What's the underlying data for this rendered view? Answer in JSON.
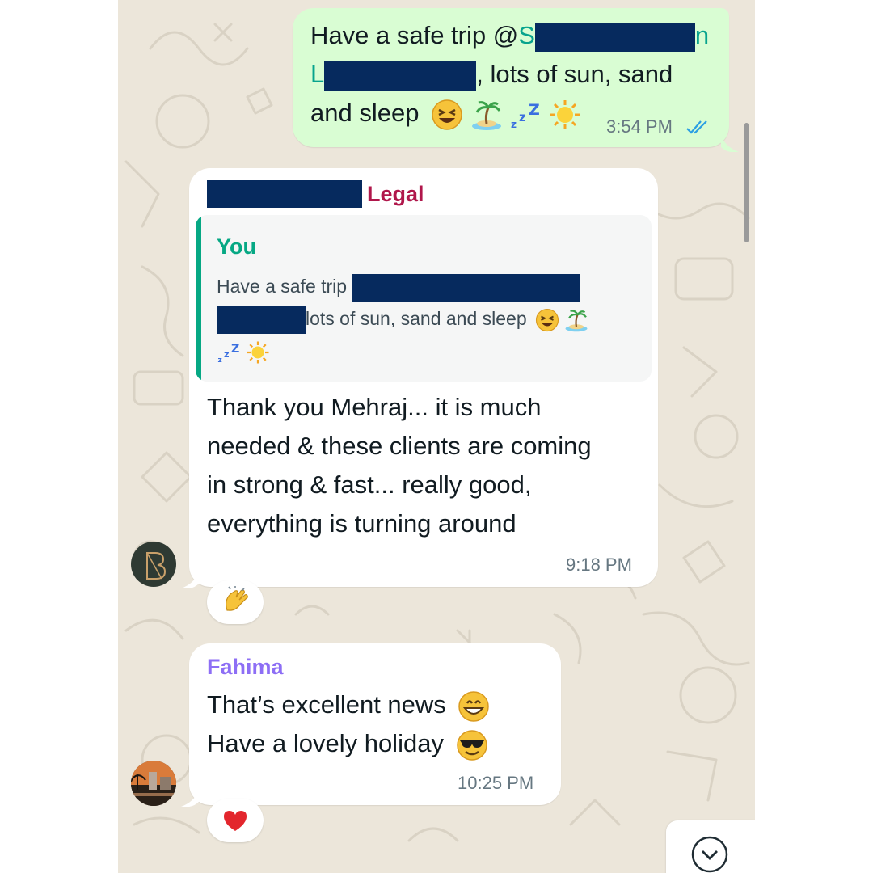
{
  "colors": {
    "background": "#ece6da",
    "outgoing_bubble": "#d9fdd3",
    "incoming_bubble": "#ffffff",
    "sender_legal": "#b0174b",
    "sender_you": "#06a884",
    "sender_fahima": "#8d6ef5",
    "mention": "#07a38d",
    "read_ticks": "#2b9fe3",
    "redaction": "#062a5e"
  },
  "messages": [
    {
      "direction": "outgoing",
      "text_line1": "Have a safe trip @",
      "mention_lead1": "S",
      "mention_tail1": "n",
      "mention_lead2": "L",
      "text_line2_rest": ", lots of sun, sand",
      "text_line3": "and sleep",
      "emojis": [
        "laughing-face",
        "desert-island",
        "zzz",
        "sun"
      ],
      "time": "3:54 PM",
      "status": "read"
    },
    {
      "direction": "incoming",
      "sender_suffix": "Legal",
      "quote": {
        "author": "You",
        "line1": "Have a safe trip",
        "line2": "lots of sun, sand and sleep",
        "emojis": [
          "laughing-face",
          "desert-island",
          "zzz",
          "sun"
        ]
      },
      "text_lines": [
        "Thank you Mehraj... it is much",
        "needed & these clients are coming",
        "in strong & fast... really good,",
        "everything is turning around"
      ],
      "time": "9:18 PM",
      "reaction": "clapping-hands"
    },
    {
      "direction": "incoming",
      "sender": "Fahima",
      "text_lines": [
        "That’s excellent news",
        "Have a lovely holiday"
      ],
      "line_emojis": [
        "grinning-face",
        "sunglasses-face"
      ],
      "time": "10:25 PM",
      "reaction": "red-heart"
    }
  ]
}
